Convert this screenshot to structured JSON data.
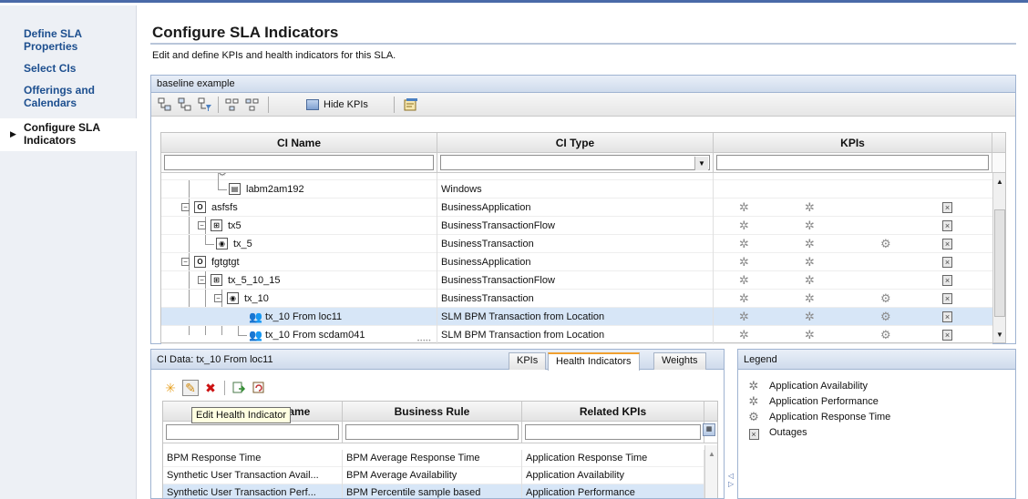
{
  "wizard": {
    "steps": [
      {
        "label": "Define SLA Properties"
      },
      {
        "label": "Select CIs"
      },
      {
        "label": "Offerings and Calendars"
      },
      {
        "label": "Configure SLA Indicators"
      }
    ],
    "current_index": 3
  },
  "page": {
    "title": "Configure SLA Indicators",
    "subtitle": "Edit and define KPIs and health indicators for this SLA."
  },
  "main_panel": {
    "title": "baseline example",
    "toolbar": {
      "hide_kpis_label": "Hide KPIs"
    },
    "columns": {
      "ci_name": "CI Name",
      "ci_type": "CI Type",
      "kpis": "KPIs"
    },
    "rows": [
      {
        "name": "labm2am192",
        "type": "Windows",
        "kpis": []
      },
      {
        "name": "asfsfs",
        "type": "BusinessApplication",
        "kpis": [
          "availability",
          "performance",
          "outages"
        ]
      },
      {
        "name": "tx5",
        "type": "BusinessTransactionFlow",
        "kpis": [
          "availability",
          "performance",
          "outages"
        ]
      },
      {
        "name": "tx_5",
        "type": "BusinessTransaction",
        "kpis": [
          "availability",
          "performance",
          "response-time",
          "outages"
        ]
      },
      {
        "name": "fgtgtgt",
        "type": "BusinessApplication",
        "kpis": [
          "availability",
          "performance",
          "outages"
        ]
      },
      {
        "name": "tx_5_10_15",
        "type": "BusinessTransactionFlow",
        "kpis": [
          "availability",
          "performance",
          "outages"
        ]
      },
      {
        "name": "tx_10",
        "type": "BusinessTransaction",
        "kpis": [
          "availability",
          "performance",
          "response-time",
          "outages"
        ]
      },
      {
        "name": "tx_10 From loc11",
        "type": "SLM BPM Transaction from Location",
        "kpis": [
          "availability",
          "performance",
          "response-time",
          "outages"
        ],
        "selected": true
      },
      {
        "name": "tx_10 From scdam041",
        "type": "SLM BPM Transaction from Location",
        "kpis": [
          "availability",
          "performance",
          "response-time",
          "outages"
        ]
      }
    ]
  },
  "ci_data": {
    "title": "CI Data: tx_10 From loc11",
    "tabs": [
      "KPIs",
      "Health Indicators",
      "Weights"
    ],
    "active_tab": 1,
    "columns": {
      "hi_name": "Health Indicator Name",
      "business_rule": "Business Rule",
      "related_kpis": "Related KPIs"
    },
    "rows": [
      {
        "name": "BPM Response Time",
        "rule": "BPM Average Response Time",
        "kpis": "Application Response Time"
      },
      {
        "name": "Synthetic User Transaction Avail...",
        "rule": "BPM Average Availability",
        "kpis": "Application Availability"
      },
      {
        "name": "Synthetic User Transaction Perf...",
        "rule": "BPM Percentile sample based",
        "kpis": "Application Performance",
        "selected": true
      }
    ],
    "tooltip": "Edit Health Indicator"
  },
  "legend": {
    "title": "Legend",
    "items": [
      {
        "icon": "availability-icon",
        "label": "Application Availability"
      },
      {
        "icon": "performance-icon",
        "label": "Application Performance"
      },
      {
        "icon": "response-time-icon",
        "label": "Application Response Time"
      },
      {
        "icon": "outages-icon",
        "label": "Outages"
      }
    ]
  },
  "colors": {
    "accent": "#4a6aa8",
    "selection": "#d7e6f7",
    "link": "#1d4f8f"
  }
}
